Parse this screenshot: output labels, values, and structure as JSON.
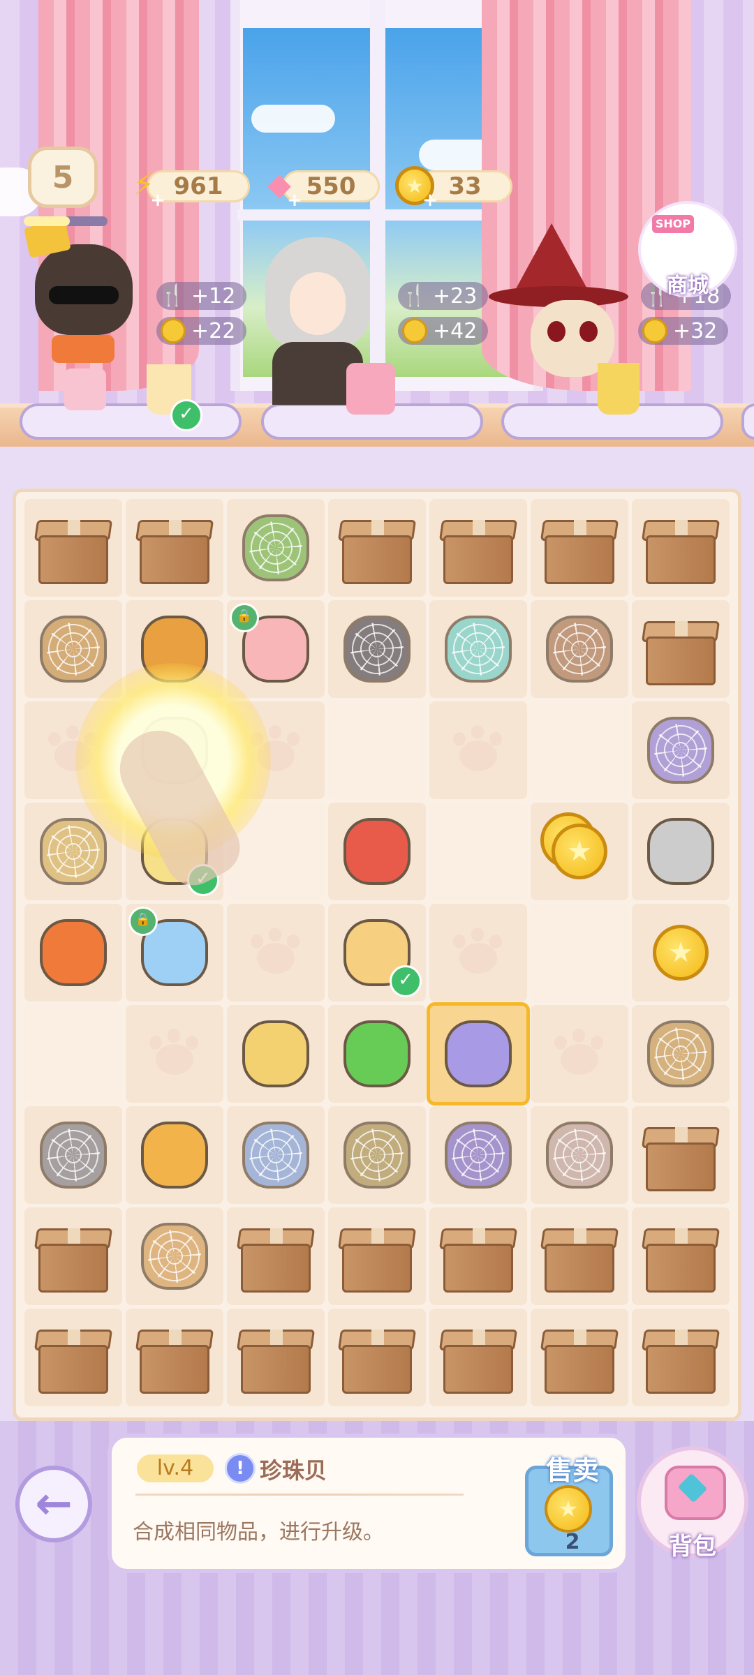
{
  "header": {
    "player_level": "5",
    "level_progress": 0.55,
    "energy": "961",
    "gems": "550",
    "coins": "33",
    "shop_label": "商城",
    "shop_sign": "SHOP",
    "shop_hidden_reward": "+18"
  },
  "customers": [
    {
      "reward_top": "+12",
      "reward_coin": "+22"
    },
    {
      "reward_top": "+23",
      "reward_coin": "+42"
    },
    {
      "reward_bottom": "+32"
    }
  ],
  "board": {
    "rows": [
      [
        "box",
        "box",
        "watering-can-webbed",
        "box",
        "box",
        "box",
        "box"
      ],
      [
        "tulip-webbed",
        "pot-glowing",
        "piggy-bank-locked",
        "cat-webbed",
        "bowl-webbed",
        "shovel-webbed",
        "box"
      ],
      [
        "paw",
        "hanger-pink",
        "paw",
        "empty",
        "paw",
        "empty",
        "flower-bouquet-webbed"
      ],
      [
        "dress-webbed",
        "lemon-drink",
        "empty",
        "fruit-basket",
        "empty",
        "coins-stack",
        "hanger-pink"
      ],
      [
        "coffee-machine",
        "gift-bag-locked",
        "paw",
        "lemonade-done",
        "paw",
        "empty",
        "coin"
      ],
      [
        "empty",
        "paw",
        "yellow-dress",
        "green-flower",
        "pearl-shell-selected",
        "paw",
        "cake-webbed"
      ],
      [
        "elephant-webbed",
        "hamster-taco",
        "ribbon-webbed",
        "bag-webbed",
        "purple-blob-webbed",
        "snail-webbed",
        "box"
      ],
      [
        "box",
        "bread-webbed",
        "box",
        "box",
        "box",
        "box",
        "box"
      ],
      [
        "box",
        "box",
        "box",
        "box",
        "box",
        "box",
        "box"
      ]
    ]
  },
  "selected_item": {
    "level": "lv.4",
    "name": "珍珠贝",
    "description": "合成相同物品，进行升级。",
    "sell_label": "售卖",
    "sell_price": "2"
  },
  "bag_label": "背包",
  "colors": {
    "accent": "#b39be0",
    "coin": "#f4b814",
    "board": "#fbf0e5"
  }
}
